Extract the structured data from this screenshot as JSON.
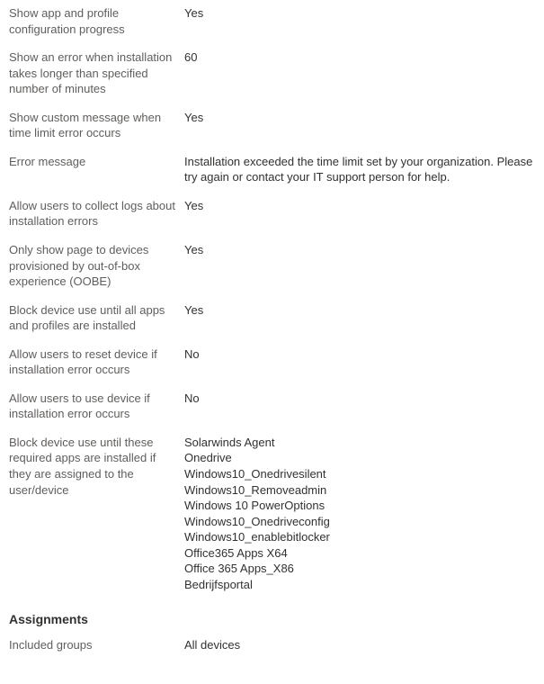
{
  "settings": [
    {
      "label": "Show app and profile configuration progress",
      "value": "Yes"
    },
    {
      "label": "Show an error when installation takes longer than specified number of minutes",
      "value": "60"
    },
    {
      "label": "Show custom message when time limit error occurs",
      "value": "Yes"
    },
    {
      "label": "Error message",
      "value": "Installation exceeded the time limit set by your organization. Please try again or contact your IT support person for help."
    },
    {
      "label": "Allow users to collect logs about installation errors",
      "value": "Yes"
    },
    {
      "label": "Only show page to devices provisioned by out-of-box experience (OOBE)",
      "value": "Yes"
    },
    {
      "label": "Block device use until all apps and profiles are installed",
      "value": "Yes"
    },
    {
      "label": "Allow users to reset device if installation error occurs",
      "value": "No"
    },
    {
      "label": "Allow users to use device if installation error occurs",
      "value": "No"
    }
  ],
  "required_apps": {
    "label": "Block device use until these required apps are installed if they are assigned to the user/device",
    "items": [
      "Solarwinds Agent",
      "Onedrive",
      "Windows10_Onedrivesilent",
      "Windows10_Removeadmin",
      "Windows 10 PowerOptions",
      "Windows10_Onedriveconfig",
      "Windows10_enablebitlocker",
      "Office365 Apps X64",
      "Office 365 Apps_X86",
      "Bedrijfsportal"
    ]
  },
  "assignments": {
    "heading": "Assignments",
    "included_groups_label": "Included groups",
    "included_groups_value": "All devices"
  }
}
